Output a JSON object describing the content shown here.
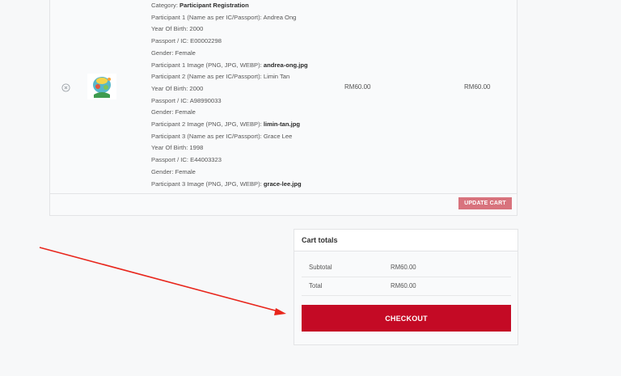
{
  "cart": {
    "meta_lines": [
      {
        "label": "Category: ",
        "value": "Participant Registration",
        "strong": true
      },
      {
        "label": "Participant 1 (Name as per IC/Passport): ",
        "value": "Andrea Ong",
        "strong": false
      },
      {
        "label": "Year Of Birth: ",
        "value": "2000",
        "strong": false
      },
      {
        "label": "Passport / IC: ",
        "value": "E00002298",
        "strong": false
      },
      {
        "label": "Gender: ",
        "value": "Female",
        "strong": false
      },
      {
        "label": "Participant 1 Image (PNG, JPG, WEBP): ",
        "value": "andrea-ong.jpg",
        "strong": true
      },
      {
        "label": "Participant 2 (Name as per IC/Passport): ",
        "value": "Limin Tan",
        "strong": false
      },
      {
        "label": "Year Of Birth: ",
        "value": "2000",
        "strong": false
      },
      {
        "label": "Passport / IC: ",
        "value": "A98990033",
        "strong": false
      },
      {
        "label": "Gender: ",
        "value": "Female",
        "strong": false
      },
      {
        "label": "Participant 2 Image (PNG, JPG, WEBP): ",
        "value": "limin-tan.jpg",
        "strong": true
      },
      {
        "label": "Participant 3 (Name as per IC/Passport): ",
        "value": "Grace Lee",
        "strong": false
      },
      {
        "label": "Year Of Birth: ",
        "value": "1998",
        "strong": false
      },
      {
        "label": "Passport / IC: ",
        "value": "E44003323",
        "strong": false
      },
      {
        "label": "Gender: ",
        "value": "Female",
        "strong": false
      },
      {
        "label": "Participant 3 Image (PNG, JPG, WEBP): ",
        "value": "grace-lee.jpg",
        "strong": true
      }
    ],
    "price": "RM60.00",
    "line_subtotal": "RM60.00",
    "remove_icon": "remove-circle-icon",
    "update_button": "UPDATE CART"
  },
  "totals": {
    "title": "Cart totals",
    "subtotal_label": "Subtotal",
    "subtotal_value": "RM60.00",
    "total_label": "Total",
    "total_value": "RM60.00",
    "checkout_button": "CHECKOUT"
  },
  "colors": {
    "checkout_bg": "#c40a25",
    "update_bg": "#d8737d",
    "arrow": "#e8261c"
  }
}
